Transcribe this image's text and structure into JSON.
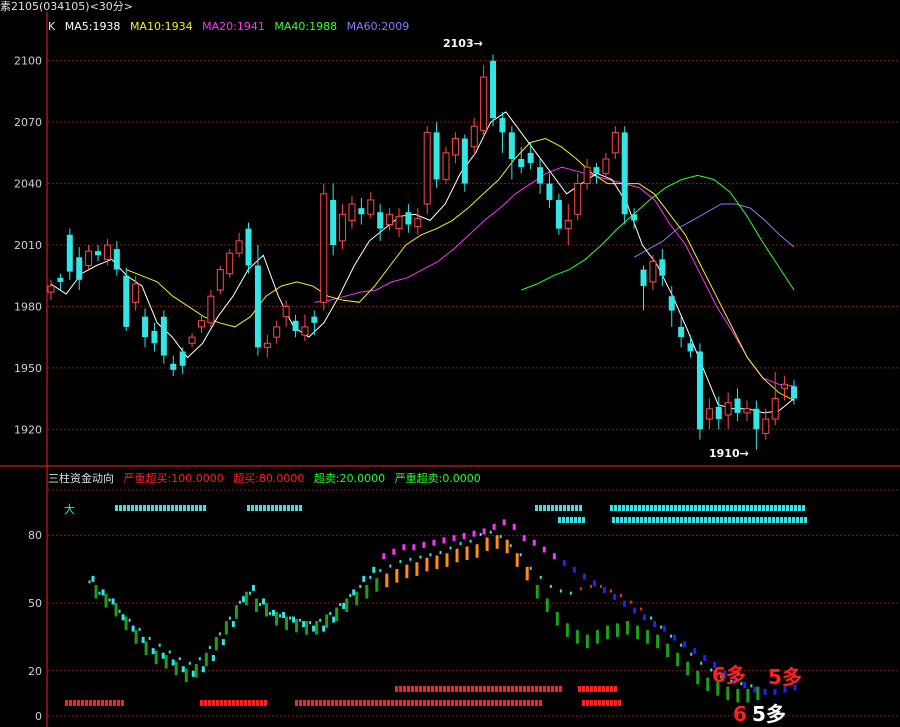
{
  "window": {
    "title": "素2105(034105)<30分>"
  },
  "colors": {
    "up": "#ff4a4a",
    "down": "#33e6e6",
    "grid": "#8a1a1a",
    "divider": "#ff2020",
    "ma5": "#ffffff",
    "ma10": "#f0f020",
    "ma20": "#ff30ff",
    "ma40": "#30ff30",
    "ma60": "#8080ff",
    "strong_buy": "#ff2020",
    "buy": "#ff2020",
    "sell": "#20ff20",
    "strong_sell": "#20ff20"
  },
  "price_panel": {
    "legend": {
      "k": "K",
      "ma5": "MA5:1938",
      "ma10": "MA10:1934",
      "ma20": "MA20:1941",
      "ma40": "MA40:1988",
      "ma60": "MA60:2009"
    },
    "high_label": "2103→",
    "low_label": "1910→"
  },
  "indicator_panel": {
    "legend": {
      "name": "三柱资金动向",
      "strong_buy": "严重超买:100.0000",
      "buy": "超买:80.0000",
      "sell": "超卖:20.0000",
      "strong_sell": "严重超卖:0.0000"
    },
    "tag_big": "大",
    "signals": {
      "s6a": "6多",
      "s5a": "5多",
      "s6b": "6",
      "s5b": "5多"
    }
  },
  "chart_data": [
    {
      "type": "candlestick",
      "ylim": [
        1905,
        2115
      ],
      "yticks": [
        1920,
        1950,
        1980,
        2010,
        2040,
        2070,
        2100
      ],
      "candles": [
        [
          1987,
          1990,
          1983,
          1993
        ],
        [
          1994,
          1992,
          1988,
          1996
        ],
        [
          2015,
          1997,
          1993,
          2018
        ],
        [
          2004,
          1993,
          1988,
          2009
        ],
        [
          2000,
          2007,
          1998,
          2010
        ],
        [
          2007,
          2005,
          2002,
          2010
        ],
        [
          2003,
          2010,
          2000,
          2013
        ],
        [
          2008,
          1998,
          1995,
          2012
        ],
        [
          1995,
          1970,
          1968,
          1999
        ],
        [
          1982,
          1991,
          1978,
          1995
        ],
        [
          1975,
          1965,
          1960,
          1979
        ],
        [
          1968,
          1962,
          1958,
          1972
        ],
        [
          1975,
          1956,
          1952,
          1978
        ],
        [
          1952,
          1949,
          1946,
          1956
        ],
        [
          1958,
          1951,
          1947,
          1960
        ],
        [
          1962,
          1965,
          1960,
          1967
        ],
        [
          1970,
          1973,
          1967,
          1976
        ],
        [
          1972,
          1985,
          1970,
          1988
        ],
        [
          1988,
          1998,
          1986,
          2000
        ],
        [
          1996,
          2006,
          1994,
          2008
        ],
        [
          2006,
          2012,
          2004,
          2016
        ],
        [
          2018,
          2000,
          1996,
          2021
        ],
        [
          2000,
          1960,
          1956,
          2010
        ],
        [
          1960,
          1962,
          1955,
          1966
        ],
        [
          1965,
          1970,
          1962,
          1973
        ],
        [
          1975,
          1980,
          1970,
          1983
        ],
        [
          1973,
          1968,
          1965,
          1976
        ],
        [
          1966,
          1970,
          1963,
          1976
        ],
        [
          1975,
          1972,
          1966,
          1978
        ],
        [
          1982,
          2035,
          1978,
          2040
        ],
        [
          2032,
          2010,
          2005,
          2040
        ],
        [
          2012,
          2025,
          2008,
          2030
        ],
        [
          2022,
          2030,
          2018,
          2034
        ],
        [
          2028,
          2025,
          2020,
          2033
        ],
        [
          2025,
          2032,
          2023,
          2036
        ],
        [
          2026,
          2018,
          2012,
          2030
        ],
        [
          2020,
          2025,
          2017,
          2028
        ],
        [
          2018,
          2024,
          2014,
          2028
        ],
        [
          2026,
          2020,
          2016,
          2030
        ],
        [
          2019,
          2023,
          2015,
          2028
        ],
        [
          2030,
          2065,
          2025,
          2068
        ],
        [
          2065,
          2042,
          2038,
          2070
        ],
        [
          2042,
          2055,
          2040,
          2058
        ],
        [
          2054,
          2062,
          2050,
          2065
        ],
        [
          2062,
          2040,
          2036,
          2064
        ],
        [
          2058,
          2068,
          2055,
          2072
        ],
        [
          2066,
          2092,
          2063,
          2098
        ],
        [
          2100,
          2072,
          2068,
          2103
        ],
        [
          2072,
          2065,
          2055,
          2075
        ],
        [
          2065,
          2052,
          2042,
          2068
        ],
        [
          2052,
          2048,
          2045,
          2058
        ],
        [
          2055,
          2050,
          2047,
          2060
        ],
        [
          2048,
          2040,
          2035,
          2052
        ],
        [
          2040,
          2032,
          2028,
          2045
        ],
        [
          2032,
          2018,
          2015,
          2035
        ],
        [
          2018,
          2022,
          2010,
          2030
        ],
        [
          2025,
          2040,
          2022,
          2045
        ],
        [
          2040,
          2048,
          2037,
          2052
        ],
        [
          2048,
          2045,
          2040,
          2050
        ],
        [
          2045,
          2052,
          2042,
          2055
        ],
        [
          2055,
          2065,
          2052,
          2068
        ],
        [
          2065,
          2025,
          2020,
          2068
        ],
        [
          2025,
          2022,
          2018,
          2028
        ],
        [
          1998,
          1990,
          1978,
          2000
        ],
        [
          1992,
          2002,
          1988,
          2005
        ],
        [
          2003,
          1995,
          1990,
          2008
        ],
        [
          1985,
          1978,
          1970,
          1990
        ],
        [
          1970,
          1965,
          1960,
          1975
        ],
        [
          1962,
          1958,
          1955,
          1966
        ],
        [
          1958,
          1920,
          1915,
          1962
        ],
        [
          1925,
          1930,
          1920,
          1935
        ],
        [
          1931,
          1925,
          1920,
          1936
        ],
        [
          1927,
          1933,
          1920,
          1938
        ],
        [
          1935,
          1928,
          1924,
          1940
        ],
        [
          1928,
          1930,
          1924,
          1934
        ],
        [
          1930,
          1920,
          1910,
          1934
        ],
        [
          1918,
          1925,
          1915,
          1930
        ],
        [
          1925,
          1935,
          1922,
          1948
        ],
        [
          1940,
          1942,
          1934,
          1946
        ],
        [
          1941,
          1935,
          1932,
          1944
        ]
      ],
      "ma": {
        "ma5": [
          [
            1991,
            1986
          ],
          [
            1996,
            2000
          ],
          [
            2003,
            1995
          ],
          [
            1990,
            1972
          ],
          [
            1965,
            1955
          ],
          [
            1962,
            1975
          ],
          [
            1985,
            1998
          ],
          [
            2005,
            1985
          ],
          [
            1970,
            1965
          ],
          [
            1972,
            1985
          ],
          [
            2000,
            2012
          ],
          [
            2018,
            2024
          ],
          [
            2025,
            2022
          ],
          [
            2030,
            2045
          ],
          [
            2055,
            2070
          ],
          [
            2075,
            2065
          ],
          [
            2055,
            2045
          ],
          [
            2035,
            2040
          ],
          [
            2045,
            2042
          ],
          [
            2030,
            2010
          ],
          [
            2000,
            1985
          ],
          [
            1968,
            1950
          ],
          [
            1932,
            1930
          ],
          [
            1930,
            1928
          ],
          [
            1929,
            1935
          ]
        ],
        "ma10": [
          [
            1998,
            1995
          ],
          [
            1992,
            1985
          ],
          [
            1980,
            1975
          ],
          [
            1972,
            1970
          ],
          [
            1975,
            1985
          ],
          [
            1990,
            1992
          ],
          [
            1990,
            1985
          ],
          [
            1983,
            1982
          ],
          [
            1990,
            2000
          ],
          [
            2010,
            2015
          ],
          [
            2018,
            2022
          ],
          [
            2028,
            2035
          ],
          [
            2042,
            2052
          ],
          [
            2060,
            2062
          ],
          [
            2058,
            2052
          ],
          [
            2045,
            2040
          ],
          [
            2040,
            2040
          ],
          [
            2035,
            2025
          ],
          [
            2015,
            2000
          ],
          [
            1985,
            1970
          ],
          [
            1955,
            1945
          ],
          [
            1938,
            1934
          ]
        ],
        "ma20": [
          [
            1982,
            1983
          ],
          [
            1985,
            1987
          ],
          [
            1988,
            1992
          ],
          [
            1994,
            1998
          ],
          [
            2002,
            2008
          ],
          [
            2015,
            2022
          ],
          [
            2028,
            2035
          ],
          [
            2040,
            2045
          ],
          [
            2048,
            2046
          ],
          [
            2044,
            2042
          ],
          [
            2040,
            2038
          ],
          [
            2032,
            2020
          ],
          [
            2010,
            1995
          ],
          [
            1980,
            1968
          ],
          [
            1955,
            1945
          ],
          [
            1942,
            1941
          ]
        ],
        "ma40": [
          [
            1988,
            1991
          ],
          [
            1995,
            1998
          ],
          [
            2003,
            2010
          ],
          [
            2018,
            2025
          ],
          [
            2032,
            2038
          ],
          [
            2042,
            2044
          ],
          [
            2042,
            2036
          ],
          [
            2025,
            2012
          ],
          [
            2000,
            1988
          ]
        ],
        "ma60": [
          [
            2004,
            2008
          ],
          [
            2012,
            2018
          ],
          [
            2022,
            2026
          ],
          [
            2030,
            2030
          ],
          [
            2028,
            2022
          ],
          [
            2015,
            2009
          ]
        ]
      }
    },
    {
      "type": "bar",
      "name": "三柱资金动向",
      "ylim": [
        0,
        100
      ],
      "yticks": [
        0,
        20,
        50,
        80
      ],
      "level_lines": [
        0,
        20,
        50,
        80,
        100
      ],
      "series_a": [
        62,
        56,
        52,
        45,
        40,
        35,
        30,
        28,
        25,
        22,
        20,
        22,
        27,
        34,
        42,
        53,
        58,
        52,
        47,
        46,
        44,
        42,
        40,
        40,
        44,
        50,
        56,
        62,
        66,
        72,
        74,
        76,
        76,
        77,
        78,
        79,
        80,
        81,
        82,
        83,
        85,
        87,
        85,
        80,
        78,
        75,
        72,
        69,
        66,
        63,
        60,
        57,
        54,
        51,
        48,
        45,
        42,
        40,
        36,
        33,
        30,
        27,
        24,
        20,
        17,
        15,
        13,
        12,
        12,
        13,
        14
      ],
      "series_b": [
        58,
        54,
        50,
        44,
        38,
        33,
        29,
        27,
        24,
        21,
        23,
        28,
        35,
        42,
        49,
        55,
        52,
        50,
        46,
        44,
        43,
        42,
        42,
        45,
        48,
        52,
        55,
        58,
        61,
        63,
        65,
        67,
        68,
        70,
        71,
        72,
        74,
        75,
        76,
        79,
        80,
        78,
        72,
        66,
        58,
        52,
        46,
        41,
        38,
        36,
        38,
        40,
        41,
        42,
        40,
        38,
        36,
        32,
        28,
        24,
        20,
        17,
        15,
        13,
        12,
        12,
        13
      ],
      "series_c": [
        60,
        55,
        52,
        47,
        43,
        39,
        35,
        32,
        29,
        26,
        24,
        26,
        31,
        37,
        44,
        51,
        55,
        50,
        46,
        45,
        44,
        43,
        42,
        43,
        46,
        50,
        54,
        58,
        62,
        65,
        67,
        69,
        70,
        71,
        72,
        73,
        75,
        77,
        78,
        81,
        82,
        80,
        76,
        72,
        66,
        62,
        58,
        56,
        55,
        57,
        58,
        58,
        56,
        54,
        51,
        48,
        44,
        40,
        36,
        32,
        28,
        24,
        21,
        18,
        16,
        15,
        14
      ]
    }
  ]
}
